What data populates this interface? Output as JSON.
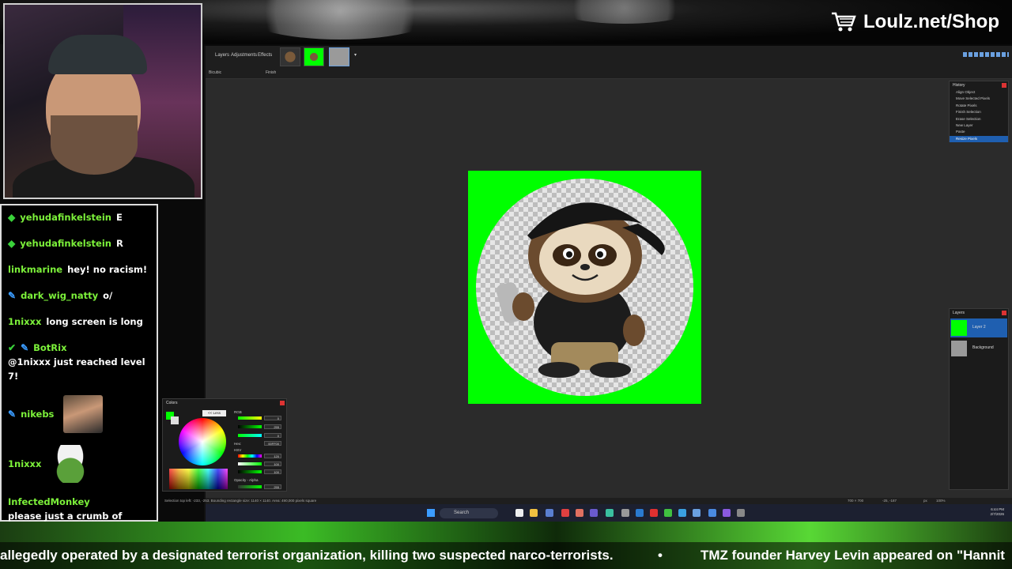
{
  "stream": {
    "shop_label": "Loulz.net/Shop",
    "ticker": [
      "allegedly operated by a designated terrorist organization, killing two suspected narco-terrorists.",
      "•",
      "TMZ founder Harvey Levin appeared on \"Hannit"
    ]
  },
  "chat": {
    "messages": [
      {
        "user": "yehudafinkelstein",
        "text": "E",
        "badge": "diamond"
      },
      {
        "user": "yehudafinkelstein",
        "text": "R",
        "badge": "diamond"
      },
      {
        "user": "linkmarine",
        "text": "hey! no racism!",
        "badge": ""
      },
      {
        "user": "dark_wig_natty",
        "text": "o/",
        "badge": "pencil"
      },
      {
        "user": "1nixxx",
        "text": "long screen is long",
        "badge": ""
      },
      {
        "user": "BotRix",
        "text": "@1nixxx just reached level 7!",
        "badge": "check-pencil"
      },
      {
        "user": "nikebs",
        "text": "",
        "badge": "pencil",
        "emote": "streamer-face-emote"
      },
      {
        "user": "1nixxx",
        "text": "",
        "badge": "",
        "emote": "pepe-hat-emote"
      },
      {
        "user": "InfectedMonkey",
        "text": "please just a crumb of news sir",
        "badge": ""
      }
    ]
  },
  "app": {
    "menu": [
      "Layers",
      "Adjustments",
      "Effects"
    ],
    "toolbar": {
      "resampling": "Bicubic",
      "finish": "Finish"
    },
    "history": {
      "title": "History",
      "items": [
        "Align Object",
        "Move Selected Pixels",
        "Rotate Pixels",
        "Finish Selection",
        "Erase Selection",
        "New Layer",
        "Paste",
        "Resize Pixels"
      ],
      "selected_index": 7
    },
    "layers": {
      "title": "Layers",
      "items": [
        "Layer 2",
        "Background"
      ],
      "selected_index": 0
    },
    "colors": {
      "title": "Colors",
      "more_button": "<< Less",
      "rgb_label": "RGB",
      "hsv_label": "HSV",
      "hex_label": "Hex:",
      "opacity_label": "Opacity - Alpha",
      "r": "0",
      "g": "255",
      "b": "0",
      "hex": "00FF00",
      "h": "120",
      "s": "100",
      "v": "100",
      "alpha": "255"
    },
    "status": {
      "selection": "Selection top left: -233, -253. Bounding rectangle size: 1140 × 1140. Area: 490,000 pixels square",
      "size": "700 × 700",
      "cursor": "-25, -187",
      "units": "px",
      "zoom": "100%"
    },
    "taskbar": {
      "search": "Search",
      "time": "6:44 PM",
      "date": "2/7/2026"
    }
  },
  "colors": {
    "chroma": "#00ff00",
    "username": "#7cf13a",
    "selection": "#1f5fb0"
  }
}
